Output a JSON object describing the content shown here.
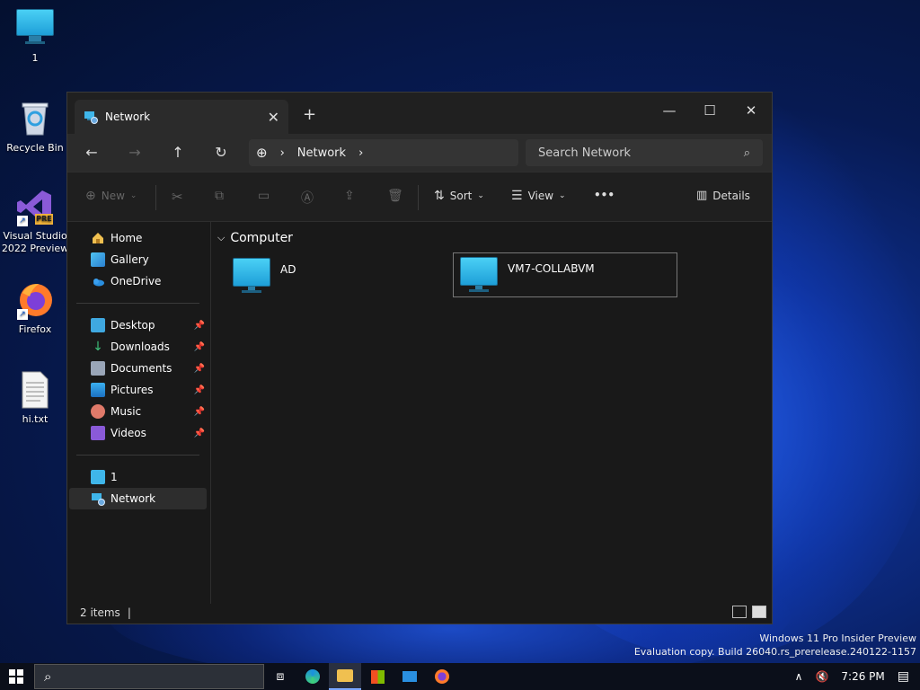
{
  "desktop": {
    "icons": [
      {
        "label": "1"
      },
      {
        "label": "Recycle Bin"
      },
      {
        "label": "Visual Studio 2022 Preview",
        "badge": "PRE"
      },
      {
        "label": "Firefox"
      },
      {
        "label": "hi.txt"
      }
    ],
    "watermark": {
      "line1": "Windows 11 Pro Insider Preview",
      "line2": "Evaluation copy. Build 26040.rs_prerelease.240122-1157"
    }
  },
  "explorer": {
    "tab_title": "Network",
    "address": {
      "segment": "Network"
    },
    "search_placeholder": "Search Network",
    "toolbar": {
      "new_label": "New",
      "sort_label": "Sort",
      "view_label": "View",
      "more_label": "•••",
      "details_label": "Details"
    },
    "nav": {
      "quick": [
        "Home",
        "Gallery",
        "OneDrive"
      ],
      "pinned": [
        "Desktop",
        "Downloads",
        "Documents",
        "Pictures",
        "Music",
        "Videos"
      ],
      "locations": [
        "1",
        "Network"
      ]
    },
    "content": {
      "group": "Computer",
      "items": [
        "AD",
        "VM7-COLLABVM"
      ]
    },
    "status": "2 items"
  },
  "taskbar": {
    "clock": "7:26 PM"
  },
  "colors": {
    "accent": "#7aa7ff",
    "window_bg": "#191919",
    "titlebar_bg": "#202020"
  }
}
